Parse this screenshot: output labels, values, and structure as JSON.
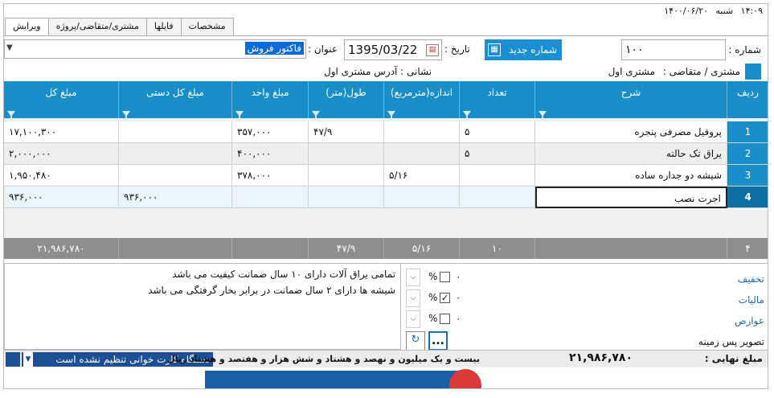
{
  "window": {
    "time": "۱۴:۰۹",
    "weekday": "شنبه",
    "date": "۱۴۰۰/۰۶/۲۰"
  },
  "tabs": [
    {
      "label": "ویرایش",
      "active": true
    },
    {
      "label": "مشتری/متقاضی/پروژه",
      "active": false
    },
    {
      "label": "فایلها",
      "active": false
    },
    {
      "label": "مشخصات",
      "active": false
    }
  ],
  "header": {
    "number_label": "شماره :",
    "number_value": "۱۰۰",
    "new_number_button": "شماره جدید",
    "date_label": "تاریخ :",
    "date_value": "1395/03/22",
    "title_label": "عنوان :",
    "title_value": "فاکتور فروش",
    "customer_label": "مشتری / متقاضی :",
    "customer_value": "مشتری اول",
    "address_label": "نشانی : آدرس مشتری اول"
  },
  "grid": {
    "columns": [
      "ردیف",
      "شرح",
      "تعداد",
      "اندازه(مترمربع)",
      "طول(متر)",
      "مبلغ واحد",
      "مبلغ کل دستی",
      "مبلغ کل"
    ],
    "rows": [
      {
        "idx": "1",
        "desc": "پروفیل مصرفی پنجره",
        "qty": "۵",
        "size": "",
        "len": "۴۷/۹",
        "unit": "۳۵۷,۰۰۰",
        "manual": "",
        "total": "۱۷,۱۰۰,۳۰۰"
      },
      {
        "idx": "2",
        "desc": "یراق تک حالته",
        "qty": "۵",
        "size": "",
        "len": "",
        "unit": "۴۰۰,۰۰۰",
        "manual": "",
        "total": "۲,۰۰۰,۰۰۰"
      },
      {
        "idx": "3",
        "desc": "شیشه دو جداره ساده",
        "qty": "",
        "size": "۵/۱۶",
        "len": "",
        "unit": "۳۷۸,۰۰۰",
        "manual": "",
        "total": "۱,۹۵۰,۴۸۰"
      },
      {
        "idx": "4",
        "desc": "اجرت نصب",
        "qty": "",
        "size": "",
        "len": "",
        "unit": "",
        "manual": "۹۳۶,۰۰۰",
        "total": "۹۳۶,۰۰۰"
      }
    ],
    "footer": {
      "idx": "۴",
      "desc": "",
      "qty": "۱۰",
      "size": "۵/۱۶",
      "len": "۴۷/۹",
      "unit": "",
      "manual": "",
      "total": "۲۱,۹۸۶,۷۸۰"
    }
  },
  "notes": {
    "line1": "تمامی یراق آلات دارای ۱۰ سال ضمانت کیفیت می باشد",
    "line2": "شیشه ها دارای ۲ سال ضمانت در برابر بخار گرفتگی می باشد"
  },
  "adjustments": {
    "discount_label": "تخفیف",
    "tax_label": "مالیات",
    "duties_label": "عوارض",
    "background_label": "تصویر پس زمینه",
    "percent_sign": "%",
    "zero": "۰",
    "more_button": "..."
  },
  "status": {
    "total_label": "مبلغ نهایی :",
    "total_value": "۲۱,۹۸۶,۷۸۰",
    "total_words": "بیست و یک میلیون و نهصد و هشتاد و شش هزار و هفتصد و هشتاد ریال",
    "card_reader": "دستگاه کارت خوانی تنظیم نشده است"
  },
  "colors": {
    "grid_header": "#1a8ec9",
    "accent_button": "#1b8fd1",
    "footer_row": "#8e8e8e"
  }
}
